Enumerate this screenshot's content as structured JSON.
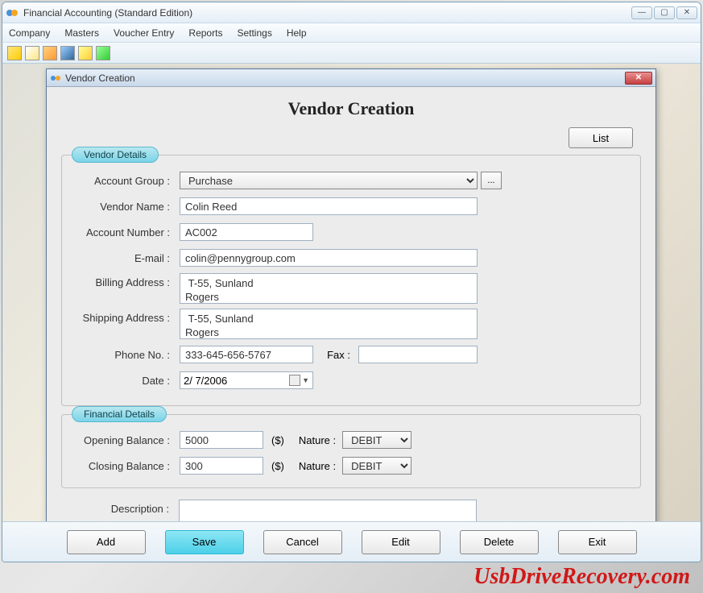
{
  "app": {
    "title": "Financial Accounting (Standard Edition)"
  },
  "menu": {
    "company": "Company",
    "masters": "Masters",
    "voucher": "Voucher Entry",
    "reports": "Reports",
    "settings": "Settings",
    "help": "Help"
  },
  "dialog": {
    "title": "Vendor Creation",
    "heading": "Vendor Creation",
    "list_btn": "List"
  },
  "vendor_details": {
    "legend": "Vendor Details",
    "labels": {
      "account_group": "Account Group :",
      "vendor_name": "Vendor Name :",
      "account_number": "Account Number :",
      "email": "E-mail :",
      "billing_address": "Billing Address :",
      "shipping_address": "Shipping Address :",
      "phone": "Phone No. :",
      "fax": "Fax :",
      "date": "Date :"
    },
    "values": {
      "account_group": "Purchase",
      "vendor_name": "Colin Reed",
      "account_number": "AC002",
      "email": "colin@pennygroup.com",
      "billing_address": " T-55, Sunland\nRogers",
      "shipping_address": " T-55, Sunland\nRogers",
      "phone": "333-645-656-5767",
      "fax": "",
      "date": " 2/  7/2006"
    }
  },
  "financial_details": {
    "legend": "Financial Details",
    "labels": {
      "opening_balance": "Opening Balance :",
      "closing_balance": "Closing Balance :",
      "currency": "($)",
      "nature": "Nature :"
    },
    "values": {
      "opening_balance": "5000",
      "closing_balance": "300",
      "nature_open": "DEBIT",
      "nature_close": "DEBIT"
    }
  },
  "description": {
    "label": "Description :",
    "value": ""
  },
  "buttons": {
    "add": "Add",
    "save": "Save",
    "cancel": "Cancel",
    "edit": "Edit",
    "delete": "Delete",
    "exit": "Exit"
  },
  "watermark": "UsbDriveRecovery.com",
  "ellipsis": "..."
}
